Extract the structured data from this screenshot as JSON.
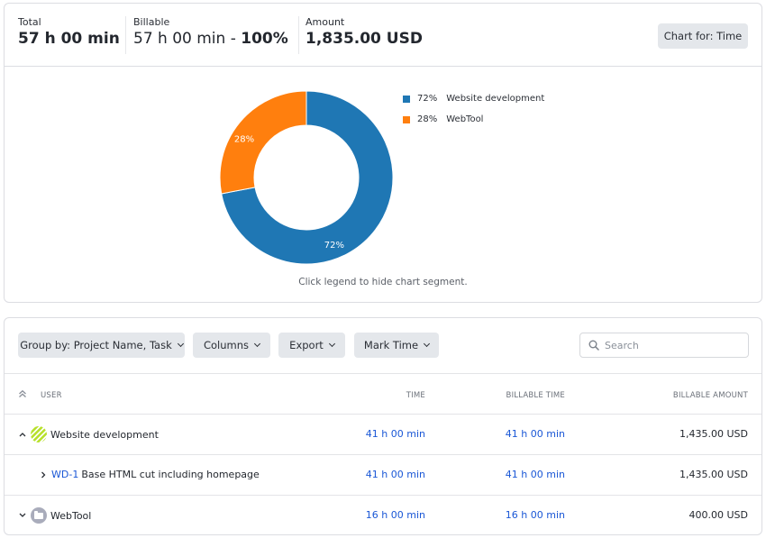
{
  "summary": {
    "total_label": "Total",
    "total_value": "57 h 00 min",
    "billable_label": "Billable",
    "billable_value": "57 h 00 min - ",
    "billable_percent": "100%",
    "amount_label": "Amount",
    "amount_value": "1,835.00 USD",
    "chart_for_button": "Chart for: Time"
  },
  "chart_data": {
    "type": "pie",
    "variant": "donut",
    "title": "",
    "labels": [
      "Website development",
      "WebTool"
    ],
    "values": [
      72,
      28
    ],
    "unit": "%",
    "slice_labels": [
      "72%",
      "28%"
    ],
    "colors": [
      "#1f77b4",
      "#ff7f0e"
    ],
    "legend_placement": "right",
    "legend": [
      {
        "percent": "72%",
        "label": "Website development",
        "color": "#1f77b4"
      },
      {
        "percent": "28%",
        "label": "WebTool",
        "color": "#ff7f0e"
      }
    ],
    "hint": "Click legend to hide chart segment."
  },
  "toolbar": {
    "group_by": "Group by: Project Name, Task",
    "columns": "Columns",
    "export": "Export",
    "mark_time": "Mark Time",
    "search_placeholder": "Search",
    "search_value": ""
  },
  "table": {
    "columns": [
      "USER",
      "TIME",
      "BILLABLE TIME",
      "BILLABLE AMOUNT"
    ],
    "rows": [
      {
        "type": "project",
        "expanded": true,
        "avatar": "striped-green",
        "name": "Website development",
        "time": "41 h 00 min",
        "billable_time": "41 h 00 min",
        "billable_amount": "1,435.00 USD"
      },
      {
        "type": "task",
        "expanded": false,
        "task_id": "WD-1",
        "name": "Base HTML cut including homepage",
        "time": "41 h 00 min",
        "billable_time": "41 h 00 min",
        "billable_amount": "1,435.00 USD"
      },
      {
        "type": "project",
        "expanded": false,
        "avatar": "folder-gray",
        "name": "WebTool",
        "time": "16 h 00 min",
        "billable_time": "16 h 00 min",
        "billable_amount": "400.00 USD"
      }
    ]
  },
  "colors": {
    "link": "#1a57d6",
    "button_bg": "#e4e7eb",
    "border": "#dcdde2"
  }
}
